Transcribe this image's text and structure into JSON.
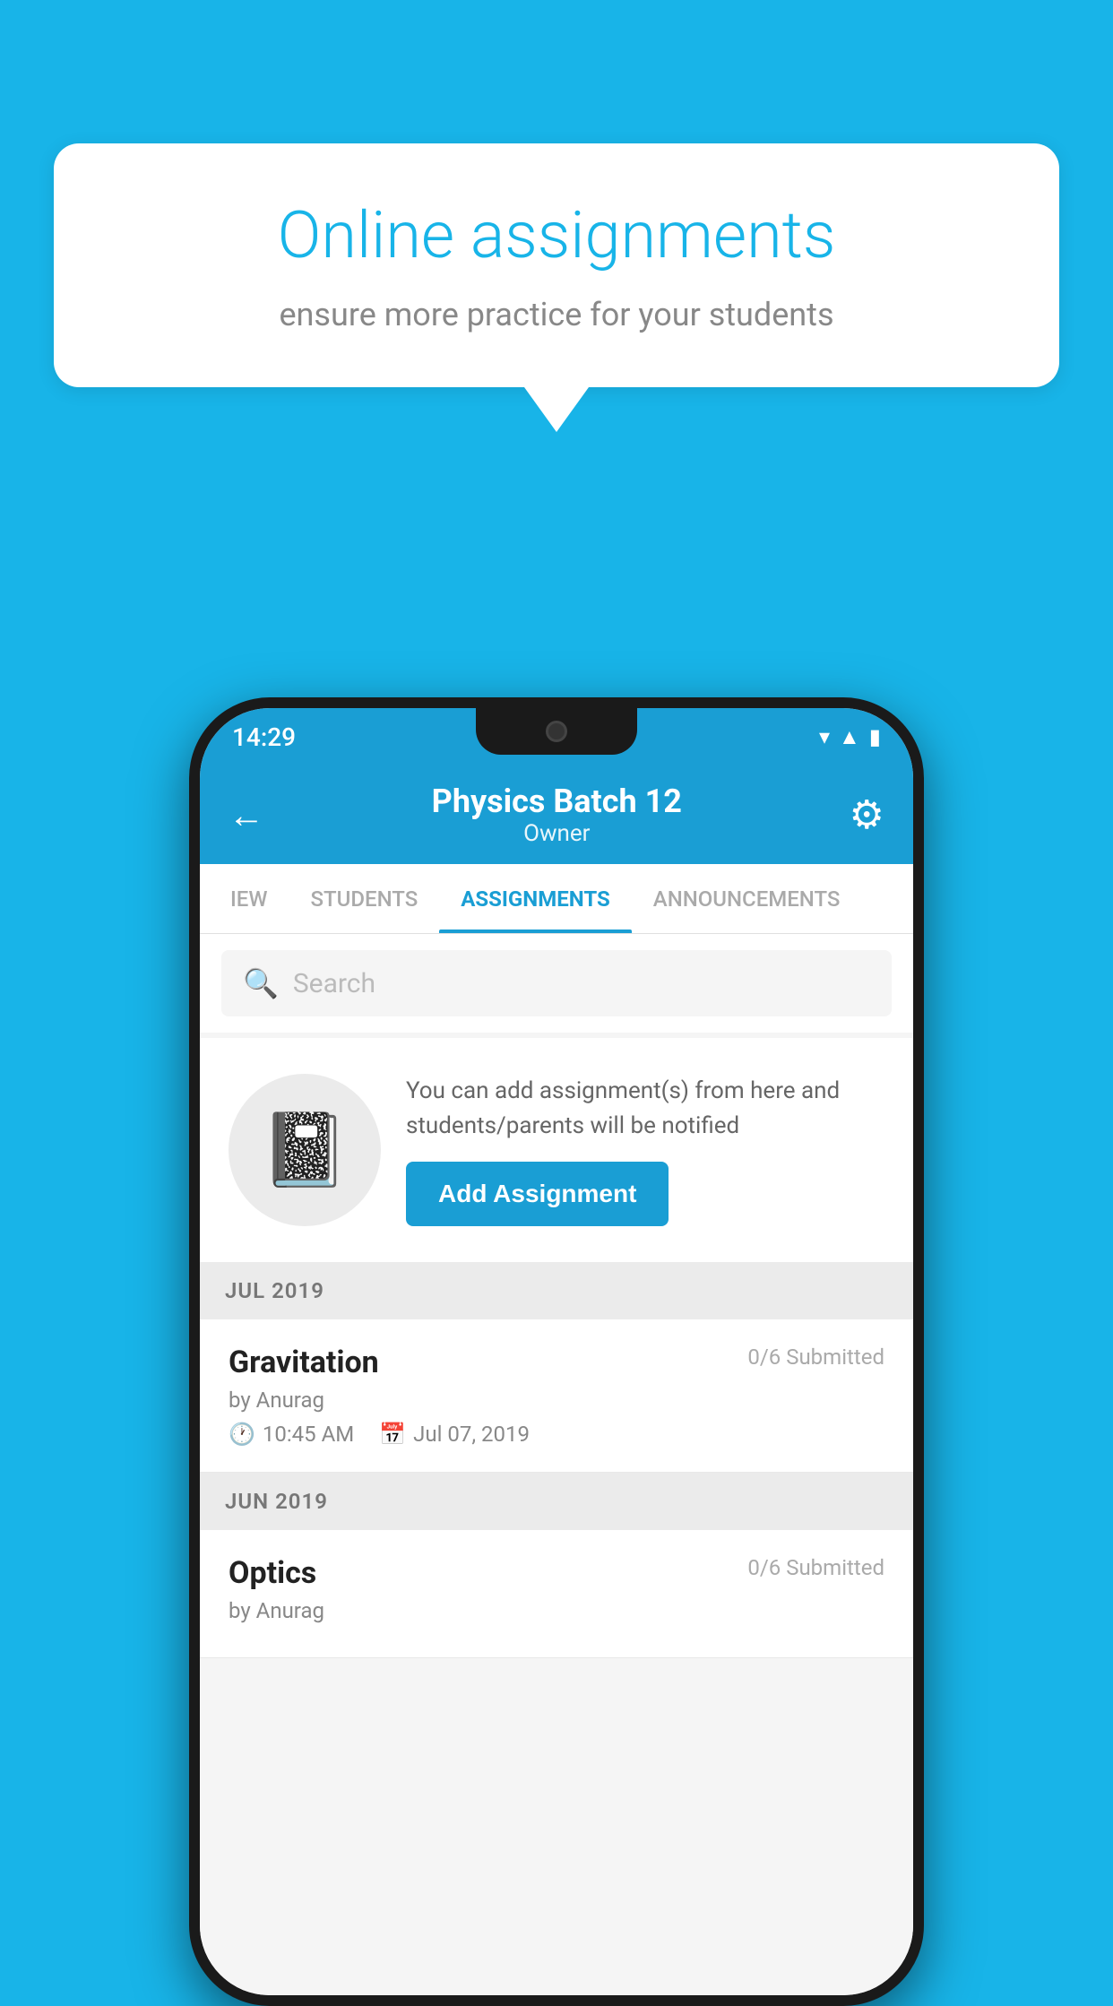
{
  "background_color": "#18b4e8",
  "speech_bubble": {
    "title": "Online assignments",
    "subtitle": "ensure more practice for your students"
  },
  "status_bar": {
    "time": "14:29",
    "icons": [
      "wifi",
      "signal",
      "battery"
    ]
  },
  "header": {
    "title": "Physics Batch 12",
    "subtitle": "Owner",
    "back_label": "←",
    "gear_label": "⚙"
  },
  "tabs": [
    {
      "label": "IEW",
      "active": false
    },
    {
      "label": "STUDENTS",
      "active": false
    },
    {
      "label": "ASSIGNMENTS",
      "active": true
    },
    {
      "label": "ANNOUNCEMENTS",
      "active": false
    }
  ],
  "search": {
    "placeholder": "Search"
  },
  "promo": {
    "description": "You can add assignment(s) from here and students/parents will be notified",
    "button_label": "Add Assignment"
  },
  "sections": [
    {
      "month": "JUL 2019",
      "assignments": [
        {
          "name": "Gravitation",
          "submitted": "0/6 Submitted",
          "by": "by Anurag",
          "time": "10:45 AM",
          "date": "Jul 07, 2019"
        }
      ]
    },
    {
      "month": "JUN 2019",
      "assignments": [
        {
          "name": "Optics",
          "submitted": "0/6 Submitted",
          "by": "by Anurag",
          "time": "",
          "date": ""
        }
      ]
    }
  ]
}
